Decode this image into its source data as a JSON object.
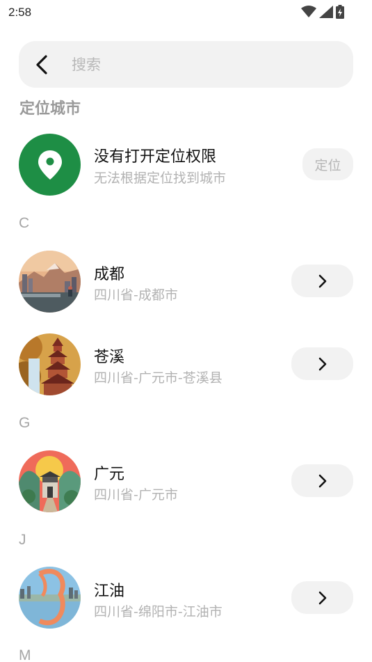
{
  "status_bar": {
    "time": "2:58",
    "icons": [
      "wifi-icon",
      "signal-icon",
      "battery-charging-icon"
    ]
  },
  "search": {
    "placeholder": "搜索",
    "value": ""
  },
  "locate_section": {
    "title": "定位城市",
    "heading": "没有打开定位权限",
    "subtitle": "无法根据定位找到城市",
    "button_label": "定位",
    "icon": "location-pin-icon",
    "accent_color": "#1e8e45"
  },
  "groups": [
    {
      "letter": "C",
      "cities": [
        {
          "name": "成都",
          "path": "四川省-成都市"
        },
        {
          "name": "苍溪",
          "path": "四川省-广元市-苍溪县"
        }
      ]
    },
    {
      "letter": "G",
      "cities": [
        {
          "name": "广元",
          "path": "四川省-广元市"
        }
      ]
    },
    {
      "letter": "J",
      "cities": [
        {
          "name": "江油",
          "path": "四川省-绵阳市-江油市"
        }
      ]
    },
    {
      "letter": "M",
      "cities": []
    }
  ]
}
